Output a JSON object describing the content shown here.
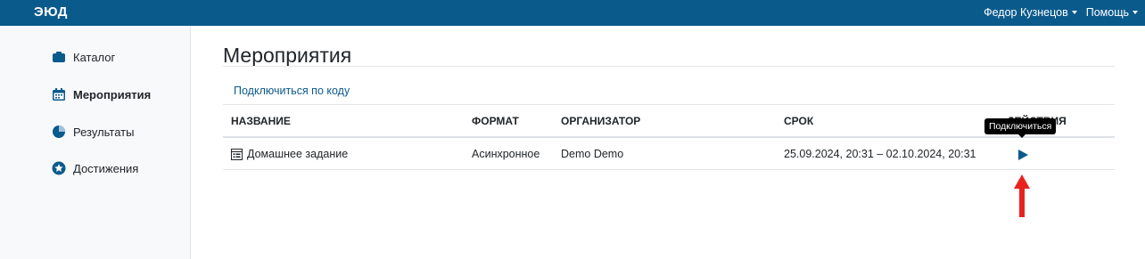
{
  "topbar": {
    "logo": "ЭЮД",
    "user_menu": "Федор Кузнецов",
    "help_menu": "Помощь"
  },
  "sidebar": {
    "items": [
      {
        "label": "Каталог",
        "icon": "catalog-icon"
      },
      {
        "label": "Мероприятия",
        "icon": "calendar-icon",
        "active": true
      },
      {
        "label": "Результаты",
        "icon": "pie-chart-icon"
      },
      {
        "label": "Достижения",
        "icon": "star-badge-icon"
      }
    ]
  },
  "main": {
    "title": "Мероприятия",
    "join_by_code": "Подключиться по коду",
    "table": {
      "headers": {
        "name": "НАЗВАНИЕ",
        "format": "ФОРМАТ",
        "organizer": "ОРГАНИЗАТОР",
        "period": "СРОК",
        "actions": "ДЕЙСТВИЯ"
      },
      "rows": [
        {
          "name": "Домашнее задание",
          "format": "Асинхронное",
          "organizer": "Demo Demo",
          "period": "25.09.2024, 20:31 – 02.10.2024, 20:31",
          "action_icon": "play-icon"
        }
      ]
    },
    "tooltip": "Подключиться"
  },
  "colors": {
    "brand": "#0b5a8c",
    "annotation_arrow": "#e8231f"
  }
}
